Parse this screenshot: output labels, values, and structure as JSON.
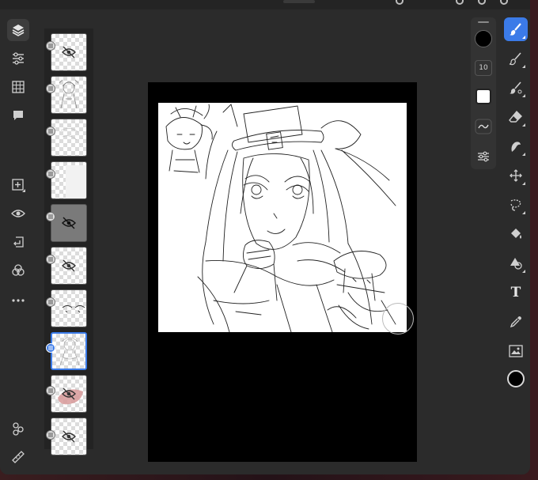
{
  "app": {
    "left_tools": [
      {
        "name": "layers",
        "active": true
      },
      {
        "name": "adjustments"
      },
      {
        "name": "grid"
      },
      {
        "name": "comments"
      },
      {
        "name": "add-layer"
      },
      {
        "name": "visibility"
      },
      {
        "name": "import"
      },
      {
        "name": "blend"
      },
      {
        "name": "more"
      },
      {
        "name": "community"
      },
      {
        "name": "ruler"
      }
    ],
    "layers": [
      {
        "index": 1,
        "hidden": true,
        "selected": false
      },
      {
        "index": 2,
        "hidden": false,
        "selected": false
      },
      {
        "index": 3,
        "hidden": false,
        "selected": false
      },
      {
        "index": 4,
        "hidden": false,
        "selected": false
      },
      {
        "index": 5,
        "hidden": true,
        "selected": false
      },
      {
        "index": 6,
        "hidden": true,
        "selected": false
      },
      {
        "index": 7,
        "hidden": false,
        "selected": false
      },
      {
        "index": 8,
        "hidden": false,
        "selected": true
      },
      {
        "index": 9,
        "hidden": true,
        "selected": false
      },
      {
        "index": 10,
        "hidden": true,
        "selected": false
      }
    ],
    "brush_panel": {
      "size_value": "10",
      "brush_color": "#000000",
      "secondary_color": "#ffffff"
    },
    "right_tools": [
      {
        "name": "paint-brush",
        "active": true
      },
      {
        "name": "pixel-brush"
      },
      {
        "name": "mixer-brush"
      },
      {
        "name": "eraser"
      },
      {
        "name": "smudge"
      },
      {
        "name": "move"
      },
      {
        "name": "lasso"
      },
      {
        "name": "fill"
      },
      {
        "name": "shapes"
      },
      {
        "name": "text",
        "label": "T"
      },
      {
        "name": "eyedropper"
      },
      {
        "name": "image"
      },
      {
        "name": "color"
      }
    ],
    "colors": {
      "accent": "#3b7be8",
      "panel": "#2b2b2b",
      "canvas_bg": "#000000",
      "paper": "#ffffff",
      "current_color": "#000000"
    }
  }
}
